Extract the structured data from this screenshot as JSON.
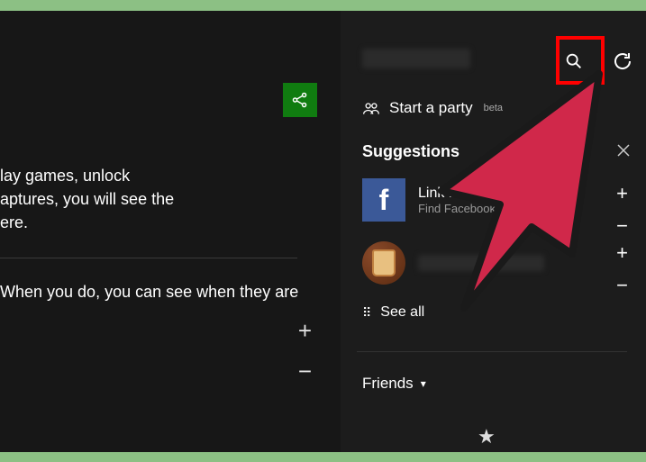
{
  "left": {
    "text1": "lay games, unlock\naptures, you will see the\nere.",
    "text2": "When you do, you can see when they are"
  },
  "right": {
    "party_label": "Start a party",
    "party_badge": "beta",
    "suggestions_header": "Suggestions",
    "fb_link_line1": "Link Facebook account",
    "fb_link_line2": "Find Facebook friends",
    "see_all_label": "See all",
    "friends_header": "Friends"
  },
  "icons": {
    "share": "share-icon",
    "search": "search-icon",
    "refresh": "refresh-icon",
    "party": "party-icon",
    "close": "close-icon",
    "grid": "grid-icon",
    "chevron": "chevron-down-icon",
    "star": "star-icon"
  },
  "colors": {
    "xbox_green": "#107c10",
    "highlight": "#ff0000",
    "cursor": "#d0284a"
  }
}
